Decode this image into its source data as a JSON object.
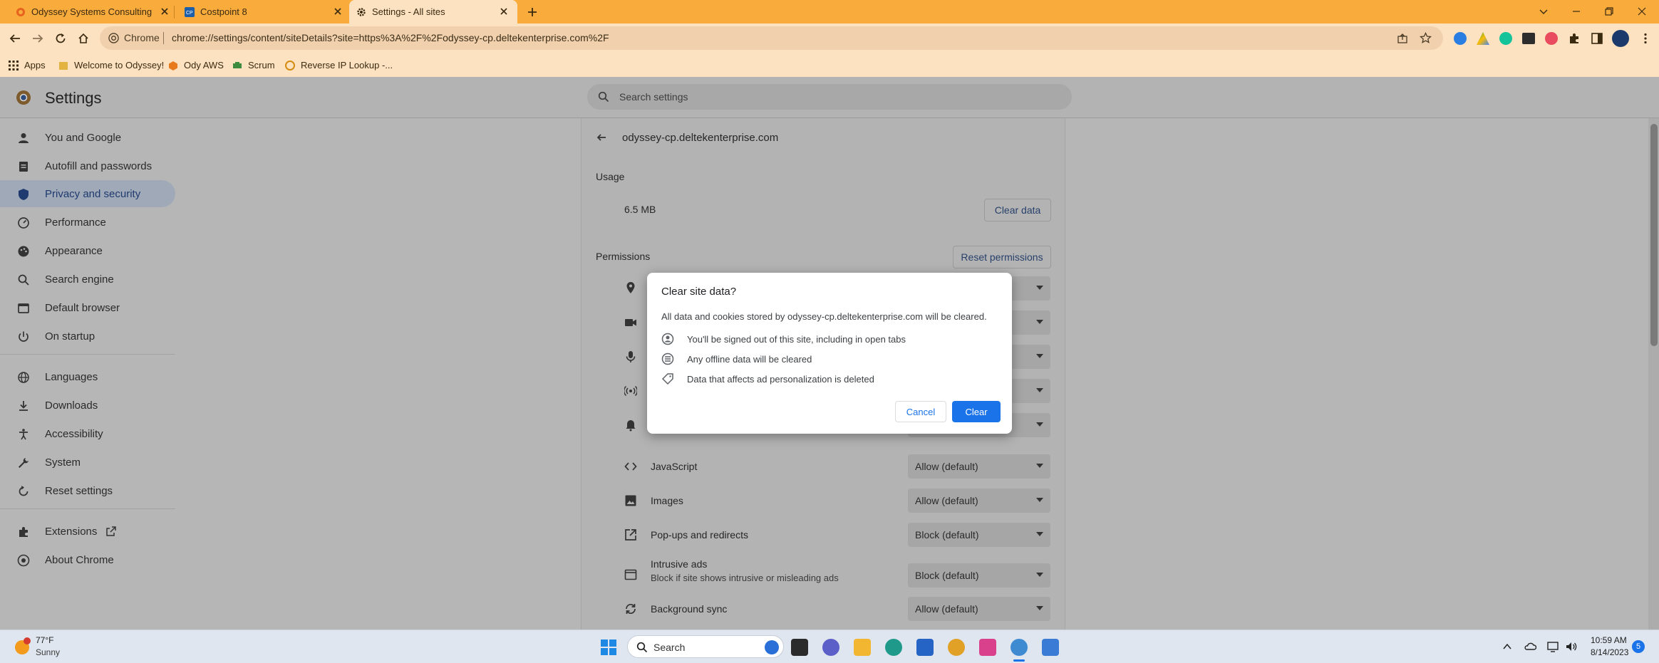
{
  "tabs": [
    {
      "title": "Odyssey Systems Consulting Gro",
      "active": false
    },
    {
      "title": "Costpoint 8",
      "active": false
    },
    {
      "title": "Settings - All sites",
      "active": true
    }
  ],
  "address": {
    "chip": "Chrome",
    "url": "chrome://settings/content/siteDetails?site=https%3A%2F%2Fodyssey-cp.deltekenterprise.com%2F"
  },
  "bookmarks": [
    "Apps",
    "Welcome to Odyssey!",
    "Ody AWS",
    "Scrum",
    "Reverse IP Lookup -..."
  ],
  "settings": {
    "title": "Settings",
    "search_placeholder": "Search settings"
  },
  "sidebar": {
    "items": [
      {
        "label": "You and Google",
        "icon": "person-icon"
      },
      {
        "label": "Autofill and passwords",
        "icon": "clipboard-icon"
      },
      {
        "label": "Privacy and security",
        "icon": "shield-icon",
        "selected": true
      },
      {
        "label": "Performance",
        "icon": "speedometer-icon"
      },
      {
        "label": "Appearance",
        "icon": "palette-icon"
      },
      {
        "label": "Search engine",
        "icon": "search-icon"
      },
      {
        "label": "Default browser",
        "icon": "browser-icon"
      },
      {
        "label": "On startup",
        "icon": "power-icon"
      },
      {
        "label": "Languages",
        "icon": "globe-icon"
      },
      {
        "label": "Downloads",
        "icon": "download-icon"
      },
      {
        "label": "Accessibility",
        "icon": "accessibility-icon"
      },
      {
        "label": "System",
        "icon": "wrench-icon"
      },
      {
        "label": "Reset settings",
        "icon": "reset-icon"
      },
      {
        "label": "Extensions",
        "icon": "puzzle-icon"
      },
      {
        "label": "About Chrome",
        "icon": "chrome-icon"
      }
    ]
  },
  "site": {
    "domain": "odyssey-cp.deltekenterprise.com",
    "usage_heading": "Usage",
    "usage_value": "6.5 MB",
    "clear_data_label": "Clear data",
    "permissions_heading": "Permissions",
    "reset_permissions_label": "Reset permissions",
    "permissions": [
      {
        "label": "JavaScript",
        "value": "Allow (default)",
        "icon": "code-icon"
      },
      {
        "label": "Images",
        "value": "Allow (default)",
        "icon": "image-icon"
      },
      {
        "label": "Pop-ups and redirects",
        "value": "Block (default)",
        "icon": "popup-icon"
      },
      {
        "label": "Intrusive ads",
        "sublabel": "Block if site shows intrusive or misleading ads",
        "value": "Block (default)",
        "icon": "ads-icon"
      },
      {
        "label": "Background sync",
        "value": "Allow (default)",
        "icon": "sync-icon"
      }
    ]
  },
  "dialog": {
    "title": "Clear site data?",
    "description": "All data and cookies stored by odyssey-cp.deltekenterprise.com will be cleared.",
    "items": [
      "You'll be signed out of this site, including in open tabs",
      "Any offline data will be cleared",
      "Data that affects ad personalization is deleted"
    ],
    "cancel_label": "Cancel",
    "clear_label": "Clear"
  },
  "taskbar": {
    "weather_temp": "77°F",
    "weather_desc": "Sunny",
    "search_placeholder": "Search",
    "time": "10:59 AM",
    "date": "8/14/2023",
    "notification_count": "5"
  },
  "colors": {
    "tabstrip": "#f9ab3c",
    "toolbar": "#fde2c2",
    "accent": "#1a73e8"
  }
}
